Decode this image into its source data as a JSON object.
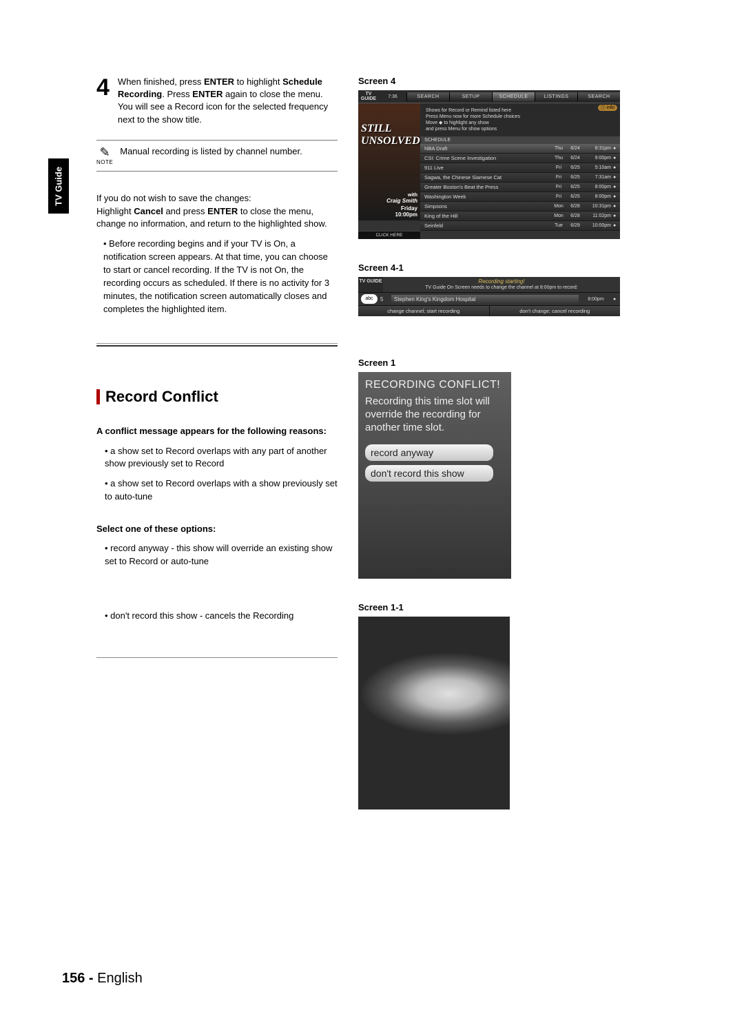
{
  "sideTab": "TV Guide",
  "step4": {
    "number": "4",
    "line1a": "When finished, press ",
    "enter1": "ENTER",
    "line1b": " to highlight ",
    "schedRec": "Schedule Recording",
    "line1c": ". Press ",
    "enter2": "ENTER",
    "line1d": " again to close the menu.",
    "line2": "You will see a Record icon for the selected frequency next to the show title."
  },
  "note": {
    "label": "NOTE",
    "text": "Manual recording is listed by channel number."
  },
  "cancelBlock": {
    "intro": "If you do not wish to save the changes:",
    "l2a": "Highlight ",
    "cancel": "Cancel",
    "l2b": " and press ",
    "enter": "ENTER",
    "l2c": " to close the menu, change no information, and return to the highlighted show.",
    "bullet": "• Before recording begins and if your TV is On, a notification screen appears. At that time, you can choose to start or cancel recording. If the TV is not On, the recording occurs as scheduled.  If there is no activity for 3 minutes, the notification screen automatically closes and completes the highlighted item."
  },
  "recordConflict": {
    "title": "Record Conflict",
    "sub1": "A conflict message appears for the following reasons:",
    "b1": "• a show set to Record overlaps with any part of another show previously set to Record",
    "b2": "• a show set to Record overlaps with a show previously set to auto-tune",
    "sub2": "Select one of these options:",
    "b3": "• record anyway - this show will override an existing show set to Record or auto-tune",
    "b4": "• don't record this show - cancels the Recording"
  },
  "labels": {
    "screen4": "Screen 4",
    "screen41": "Screen 4-1",
    "screen1": "Screen 1",
    "screen11": "Screen 1-1"
  },
  "screen4": {
    "logo": "TV GUIDE",
    "time": "7:36",
    "tabs": [
      "SEARCH",
      "SETUP",
      "SCHEDULE",
      "LISTINGS",
      "SEARCH"
    ],
    "info": "ⓘ info",
    "hint1": "Shows for Record or Remind listed here",
    "hint2": "Press Menu now for more Schedule choices",
    "hint3": "Move ◆ to highlight any show",
    "hint4": "and press Menu for show options",
    "schedHdr": "SCHEDULE",
    "leftShow": {
      "still": "STILL",
      "unsolved": "UNSOLVED",
      "with": "with",
      "craig": "Craig Smith",
      "friday": "Friday",
      "t": "10:00pm"
    },
    "clickHere": "CLICK HERE",
    "rows": [
      {
        "title": "NBA Draft",
        "day": "Thu",
        "date": "6/24",
        "time": "8:31pm",
        "sel": true
      },
      {
        "title": "CSI: Crime Scene Investigation",
        "day": "Thu",
        "date": "6/24",
        "time": "9:00pm"
      },
      {
        "title": "911 Live",
        "day": "Fri",
        "date": "6/25",
        "time": "5:10am"
      },
      {
        "title": "Sagwa, the Chinese Siamese Cat",
        "day": "Fri",
        "date": "6/25",
        "time": "7:31am"
      },
      {
        "title": "Greater Boston's Beat the Press",
        "day": "Fri",
        "date": "6/25",
        "time": "8:00pm"
      },
      {
        "title": "Washington Week",
        "day": "Fri",
        "date": "6/25",
        "time": "8:00pm"
      },
      {
        "title": "Simpsons",
        "day": "Mon",
        "date": "6/28",
        "time": "10:31pm"
      },
      {
        "title": "King of the Hill",
        "day": "Mon",
        "date": "6/28",
        "time": "11:02pm"
      },
      {
        "title": "Seinfeld",
        "day": "Tue",
        "date": "6/29",
        "time": "10:00pm"
      }
    ]
  },
  "screen41": {
    "logo": "TV GUIDE",
    "t1": "Recording starting!",
    "t2": "TV Guide On Screen needs to change the channel at   8:00pm to record:",
    "ch": "abc",
    "num": "5",
    "show": "Stephen King's Kingdom Hospital",
    "slot": "8:00pm",
    "opt1": "change channel; start recording",
    "opt2": "don't change; cancel recording"
  },
  "screen1": {
    "h": "RECORDING CONFLICT!",
    "t": "Recording this time slot will override the recording for another time slot.",
    "btn1": "record anyway",
    "btn2": "don't record this show"
  },
  "footer": {
    "page": "156 - ",
    "lang": "English"
  }
}
